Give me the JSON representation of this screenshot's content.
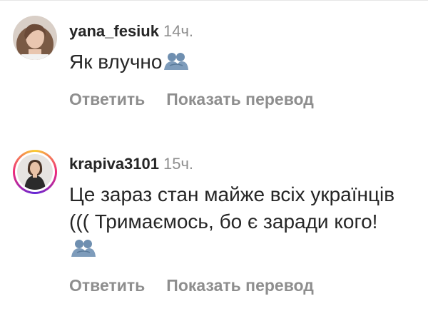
{
  "comments": [
    {
      "username": "yana_fesiuk",
      "time": "14ч.",
      "text": "Як влучно",
      "emoji": "people-hugging",
      "reply_label": "Ответить",
      "translate_label": "Показать перевод"
    },
    {
      "username": "krapiva3101",
      "time": "15ч.",
      "text": "Це зараз стан майже всіх українців ((( Тримаємось, бо є заради кого!",
      "emoji": "people-hugging",
      "reply_label": "Ответить",
      "translate_label": "Показать перевод"
    }
  ],
  "colors": {
    "text": "#262626",
    "muted": "#8e8e8e",
    "emoji": "#6f8fb0"
  }
}
